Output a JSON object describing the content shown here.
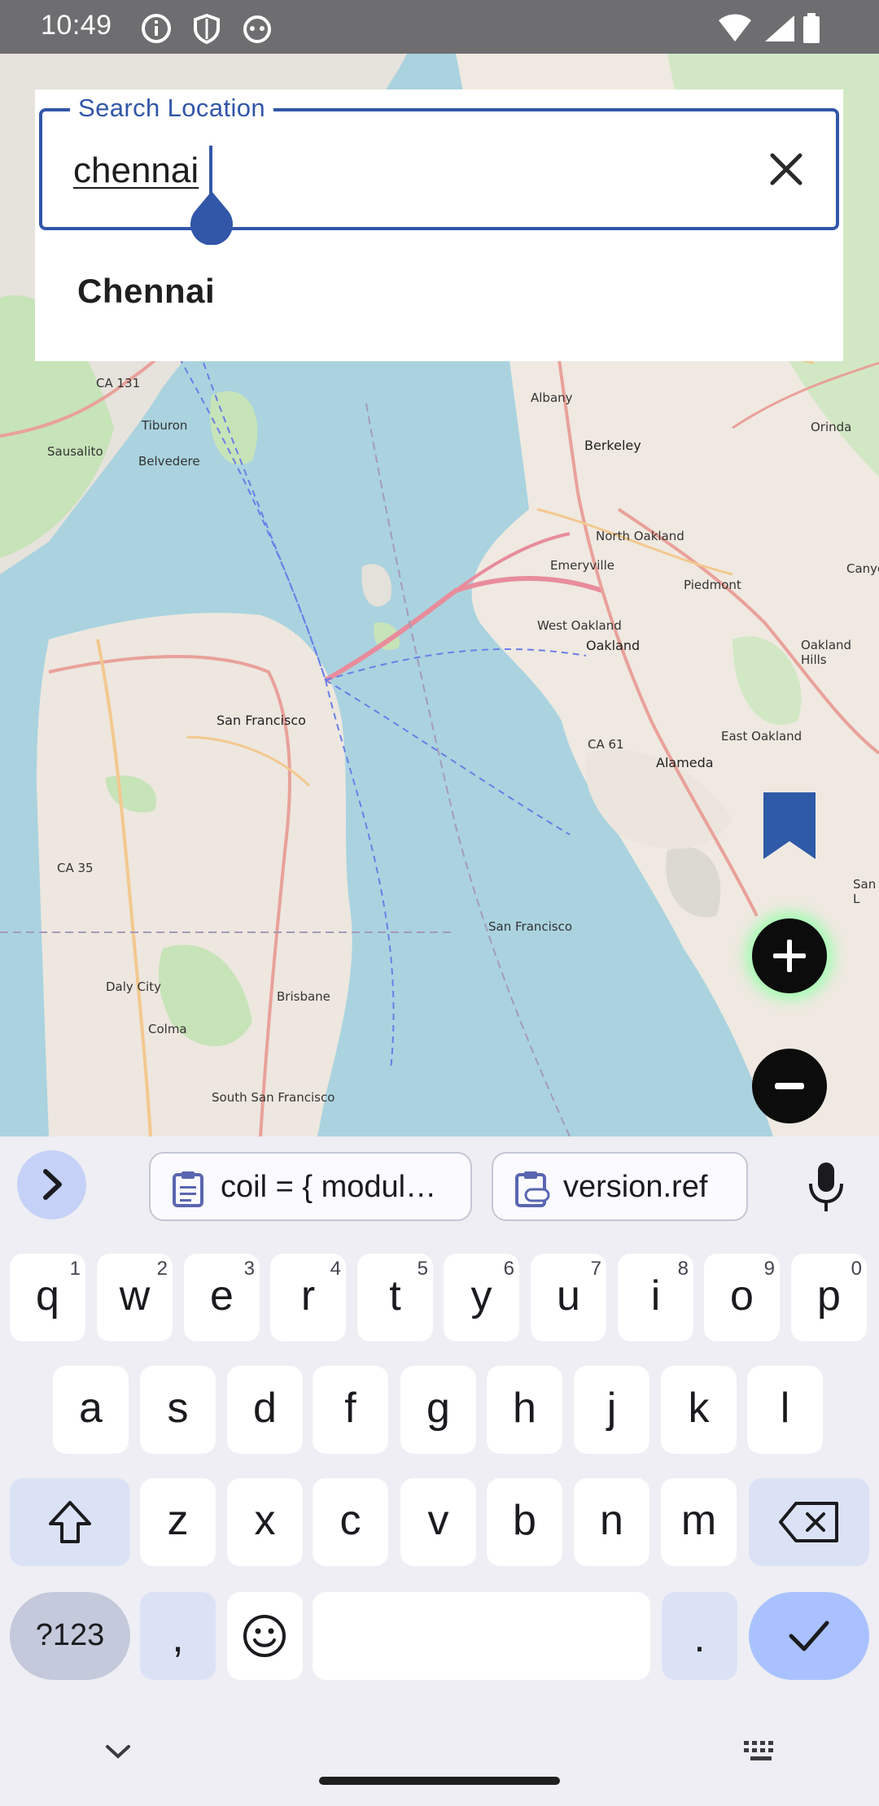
{
  "status_bar": {
    "time": "10:49"
  },
  "map": {
    "labels": [
      "San Francisco",
      "Oakland",
      "Berkeley",
      "Albany",
      "Alameda",
      "Emeryville",
      "Piedmont",
      "Orinda",
      "Sausalito",
      "Tiburon",
      "Belvedere",
      "Daly City",
      "Colma",
      "Brisbane",
      "South San Francisco",
      "West Oakland",
      "North Oakland",
      "East Oakland",
      "Oakland Hills",
      "Canyon",
      "San Francisco",
      "San L",
      "CA 131",
      "CA 35",
      "CA 61"
    ]
  },
  "search": {
    "label": "Search Location",
    "value": "chennai",
    "suggestion": "Chennai"
  },
  "keyboard": {
    "chips": [
      "coil = { modul…",
      "version.ref"
    ],
    "row1": [
      {
        "k": "q",
        "n": "1"
      },
      {
        "k": "w",
        "n": "2"
      },
      {
        "k": "e",
        "n": "3"
      },
      {
        "k": "r",
        "n": "4"
      },
      {
        "k": "t",
        "n": "5"
      },
      {
        "k": "y",
        "n": "6"
      },
      {
        "k": "u",
        "n": "7"
      },
      {
        "k": "i",
        "n": "8"
      },
      {
        "k": "o",
        "n": "9"
      },
      {
        "k": "p",
        "n": "0"
      }
    ],
    "row2": [
      "a",
      "s",
      "d",
      "f",
      "g",
      "h",
      "j",
      "k",
      "l"
    ],
    "row3": [
      "z",
      "x",
      "c",
      "v",
      "b",
      "n",
      "m"
    ],
    "symbols_label": "?123",
    "comma": ",",
    "period": "."
  },
  "colors": {
    "accent": "#3256a8",
    "status_bar": "#6e6e70",
    "keyboard_bg": "#eeeef4"
  }
}
